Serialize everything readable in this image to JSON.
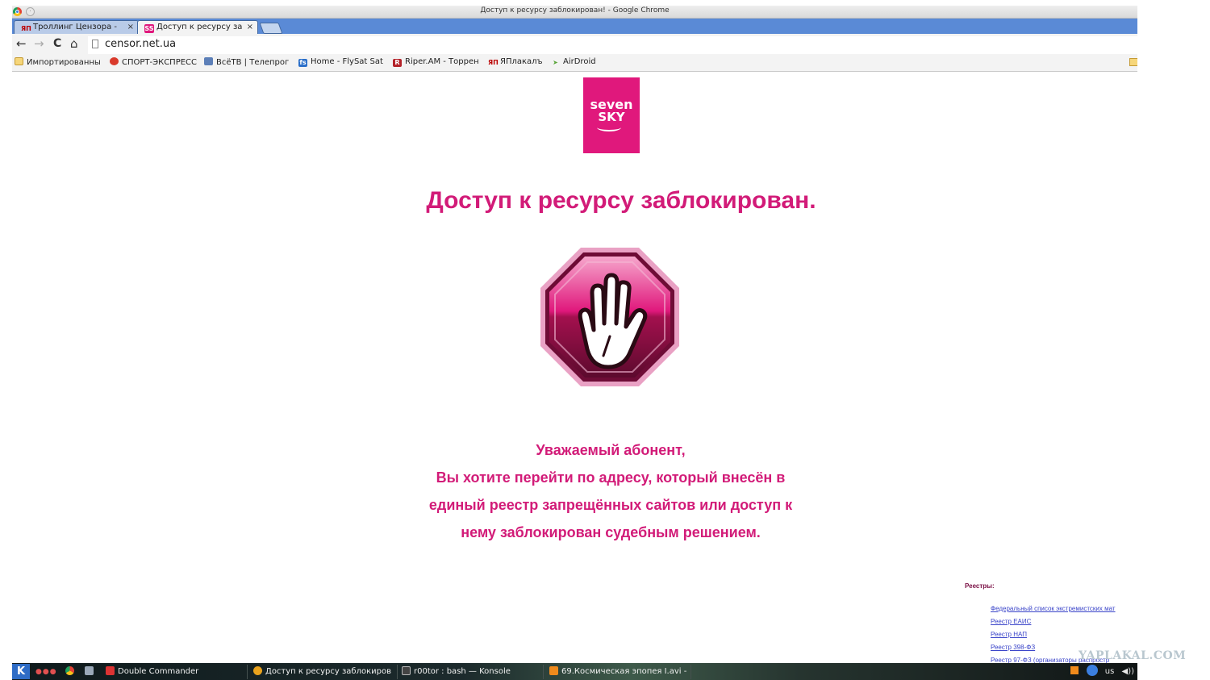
{
  "window": {
    "title": "Доступ к ресурсу заблокирован! - Google Chrome"
  },
  "tabs": [
    {
      "favicon": "ЯП",
      "label": "Троллинг Цензора -",
      "close": "×",
      "active": false
    },
    {
      "favicon": "SS",
      "label": "Доступ к ресурсу за",
      "close": "×",
      "active": true
    }
  ],
  "toolbar": {
    "url": "censor.net.ua",
    "back_icon": "←",
    "forward_icon": "→",
    "reload_icon": "C",
    "home_icon": "⌂"
  },
  "bookmarks": [
    {
      "icon": "folder-icon",
      "label": "Импортированны"
    },
    {
      "icon": "sport-icon",
      "label": "СПОРТ-ЭКСПРЕСС"
    },
    {
      "icon": "tv-icon",
      "label": "ВсёТВ | Телепрог"
    },
    {
      "icon": "flysat-icon",
      "label": "Home - FlySat Sat"
    },
    {
      "icon": "riper-icon",
      "label": "Riper.AM - Торрен"
    },
    {
      "icon": "yaplakal-icon",
      "label": "ЯПлакалъ"
    },
    {
      "icon": "airdroid-icon",
      "label": "AirDroid"
    }
  ],
  "page": {
    "logo_line1": "seven",
    "logo_line2": "SKY",
    "headline": "Доступ к ресурсу заблокирован.",
    "message_lines": [
      "Уважаемый абонент,",
      "Вы хотите перейти по адресу, который внесён в",
      "единый реестр запрещённых сайтов или доступ к",
      "нему заблокирован судебным решением."
    ],
    "registry_title": "Реестры:",
    "registry_links": [
      "Федеральный список экстремистских мат",
      "Реестр ЕАИС",
      "Реестр НАП",
      "Реестр 398-ФЗ",
      "Реестр 97-ФЗ (организаторы распростр"
    ]
  },
  "taskbar": {
    "tasks": [
      {
        "label": "Double Commander",
        "icon_color": "#d33"
      },
      {
        "label": "Доступ к ресурсу заблокиров",
        "icon_color": "#e9a21d"
      },
      {
        "label": "r00tor : bash — Konsole",
        "icon_color": "#444"
      },
      {
        "label": "69.Космическая эпопея I.avi -",
        "icon_color": "#f08a1c"
      }
    ],
    "tray": {
      "layout": "us",
      "volume": "◀))"
    }
  },
  "watermark": "YAPLAKAL.COM",
  "colors": {
    "brand": "#e0187c",
    "text_pink": "#d21b78",
    "tab_strip": "#5a8ad6"
  }
}
